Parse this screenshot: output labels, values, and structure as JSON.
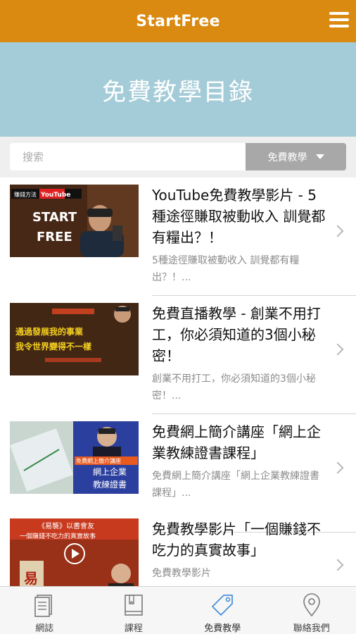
{
  "header": {
    "brand": "StartFree",
    "menu_icon": "hamburger-menu-icon"
  },
  "hero": {
    "title": "免費教學目錄"
  },
  "search": {
    "placeholder": "搜索",
    "filter_label": "免費教學"
  },
  "colors": {
    "header": "#da8a11",
    "hero": "#a4ccd8",
    "active_tab": "#4a90d9"
  },
  "items": [
    {
      "title": "YouTube免費教學影片 - 5種途徑賺取被動收入 訓覺都有糧出？！",
      "desc": "5種途徑賺取被動收入 訓覺都有糧出？！...",
      "thumb_text": [
        "賺錢方法",
        "YouTube",
        "START",
        "FREE"
      ]
    },
    {
      "title": "免費直播教學 - 創業不用打工，你必須知道的3個小秘密！",
      "desc": "創業不用打工，你必須知道的3個小秘密！...",
      "thumb_text": [
        "通過發展我的事業",
        "我令世界變得不一樣"
      ]
    },
    {
      "title": "免費網上簡介講座「網上企業教練證書課程」",
      "desc": "免費網上簡介講座「網上企業教練證書課程」...",
      "thumb_text": [
        "免費網上簡介講座",
        "網上企業",
        "教練證書"
      ]
    },
    {
      "title": "免費教學影片「一個賺錢不吃力的真實故事」",
      "desc": "免費教學影片",
      "thumb_text": [
        "《易襲》以書會友",
        "一個賺錢不吃力的真實故事",
        "易"
      ]
    }
  ],
  "tabs": [
    {
      "label": "網誌",
      "icon": "blog-document-icon",
      "active": false
    },
    {
      "label": "課程",
      "icon": "course-book-icon",
      "active": false
    },
    {
      "label": "免費教學",
      "icon": "price-tag-icon",
      "active": true
    },
    {
      "label": "聯絡我們",
      "icon": "location-pin-icon",
      "active": false
    }
  ]
}
